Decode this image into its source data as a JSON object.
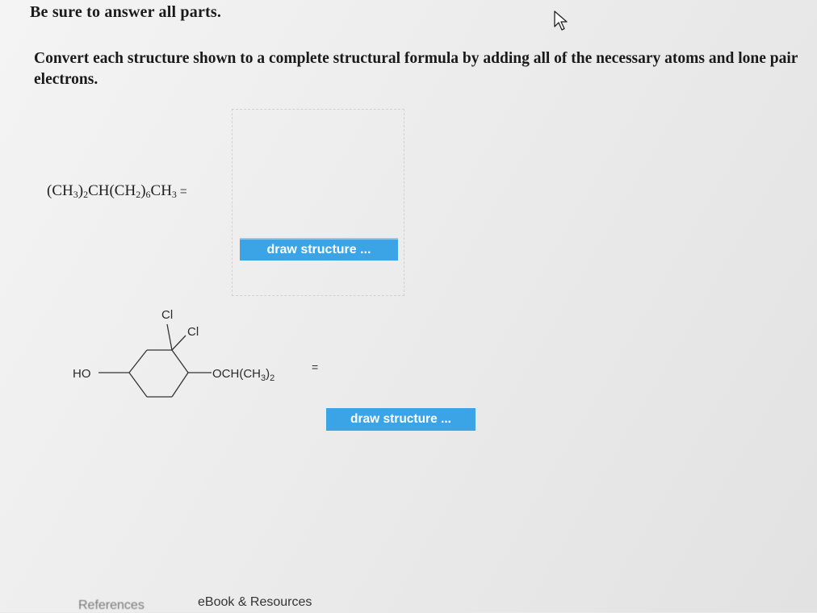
{
  "heading": "Be sure to answer all parts.",
  "instructions": "Convert each structure shown to a complete structural formula by adding all of the necessary atoms and lone pair electrons.",
  "question1": {
    "formula_parts": [
      "(CH",
      "3",
      ")",
      "2",
      "CH(CH",
      "2",
      ")",
      "6",
      "CH",
      "3"
    ],
    "equals": "=",
    "button_label": "draw structure ..."
  },
  "question2": {
    "labels": {
      "cl_top": "Cl",
      "cl_right": "Cl",
      "ho": "HO",
      "och_main": "OCH(CH",
      "och_sub1": "3",
      "och_close": ")",
      "och_sub2": "2"
    },
    "equals": "=",
    "button_label": "draw structure ..."
  },
  "footer": {
    "references": "References",
    "ebook": "eBook & Resources"
  },
  "colors": {
    "button": "#3ba4e6",
    "text": "#1a1a1a"
  },
  "icons": {
    "cursor": "mouse-pointer-icon"
  }
}
